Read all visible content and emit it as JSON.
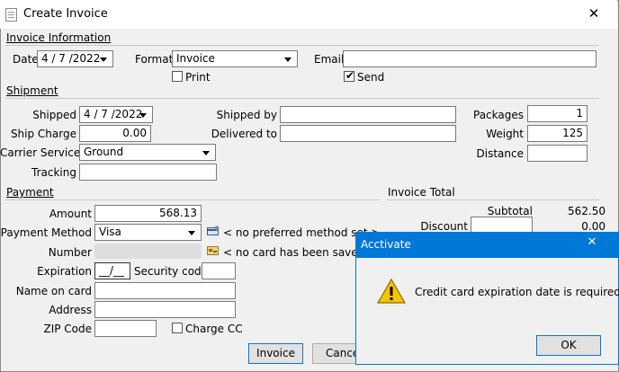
{
  "window": {
    "title": "Create Invoice",
    "close_glyph": "✕"
  },
  "invoice_info": {
    "section": "Invoice Information",
    "date_label": "Date",
    "date_value": "4 / 7 /2022",
    "format_label": "Format",
    "format_value": "Invoice",
    "email_label": "Email",
    "email_value": "",
    "print_label": "Print",
    "print_checked": false,
    "send_label": "Send",
    "send_checked": true
  },
  "shipment": {
    "section": "Shipment",
    "shipped_label": "Shipped",
    "shipped_value": "4 / 7 /2022",
    "ship_charge_label": "Ship Charge",
    "ship_charge_value": "0.00",
    "carrier_label": "Carrier Service",
    "carrier_value": "Ground",
    "tracking_label": "Tracking",
    "tracking_value": "",
    "shipped_by_label": "Shipped by",
    "shipped_by_value": "",
    "delivered_to_label": "Delivered to",
    "delivered_to_value": "",
    "packages_label": "Packages",
    "packages_value": "1",
    "weight_label": "Weight",
    "weight_value": "125",
    "distance_label": "Distance",
    "distance_value": ""
  },
  "payment": {
    "section": "Payment",
    "amount_label": "Amount",
    "amount_value": "568.13",
    "method_label": "Payment Method",
    "method_value": "Visa",
    "method_note": "< no preferred method set >",
    "number_label": "Number",
    "card_note": "< no card has been saved >",
    "expiration_label": "Expiration",
    "expiration_value": "__/__",
    "security_label": "Security code",
    "security_value": "",
    "name_label": "Name on card",
    "name_value": "",
    "address_label": "Address",
    "address_value": "",
    "zip_label": "ZIP Code",
    "zip_value": "",
    "charge_label": "Charge CC",
    "charge_checked": false
  },
  "totals": {
    "section": "Invoice Total",
    "subtotal_label": "Subtotal",
    "subtotal_value": "562.50",
    "discount_label": "Discount",
    "discount_value": "0.00"
  },
  "buttons": {
    "invoice": "Invoice",
    "cancel": "Cance"
  },
  "dialog": {
    "title": "Acctivate",
    "close_glyph": "✕",
    "message": "Credit card expiration date is required.",
    "ok": "OK"
  },
  "colors": {
    "accent": "#0078d7",
    "warning": "#f5c400"
  }
}
